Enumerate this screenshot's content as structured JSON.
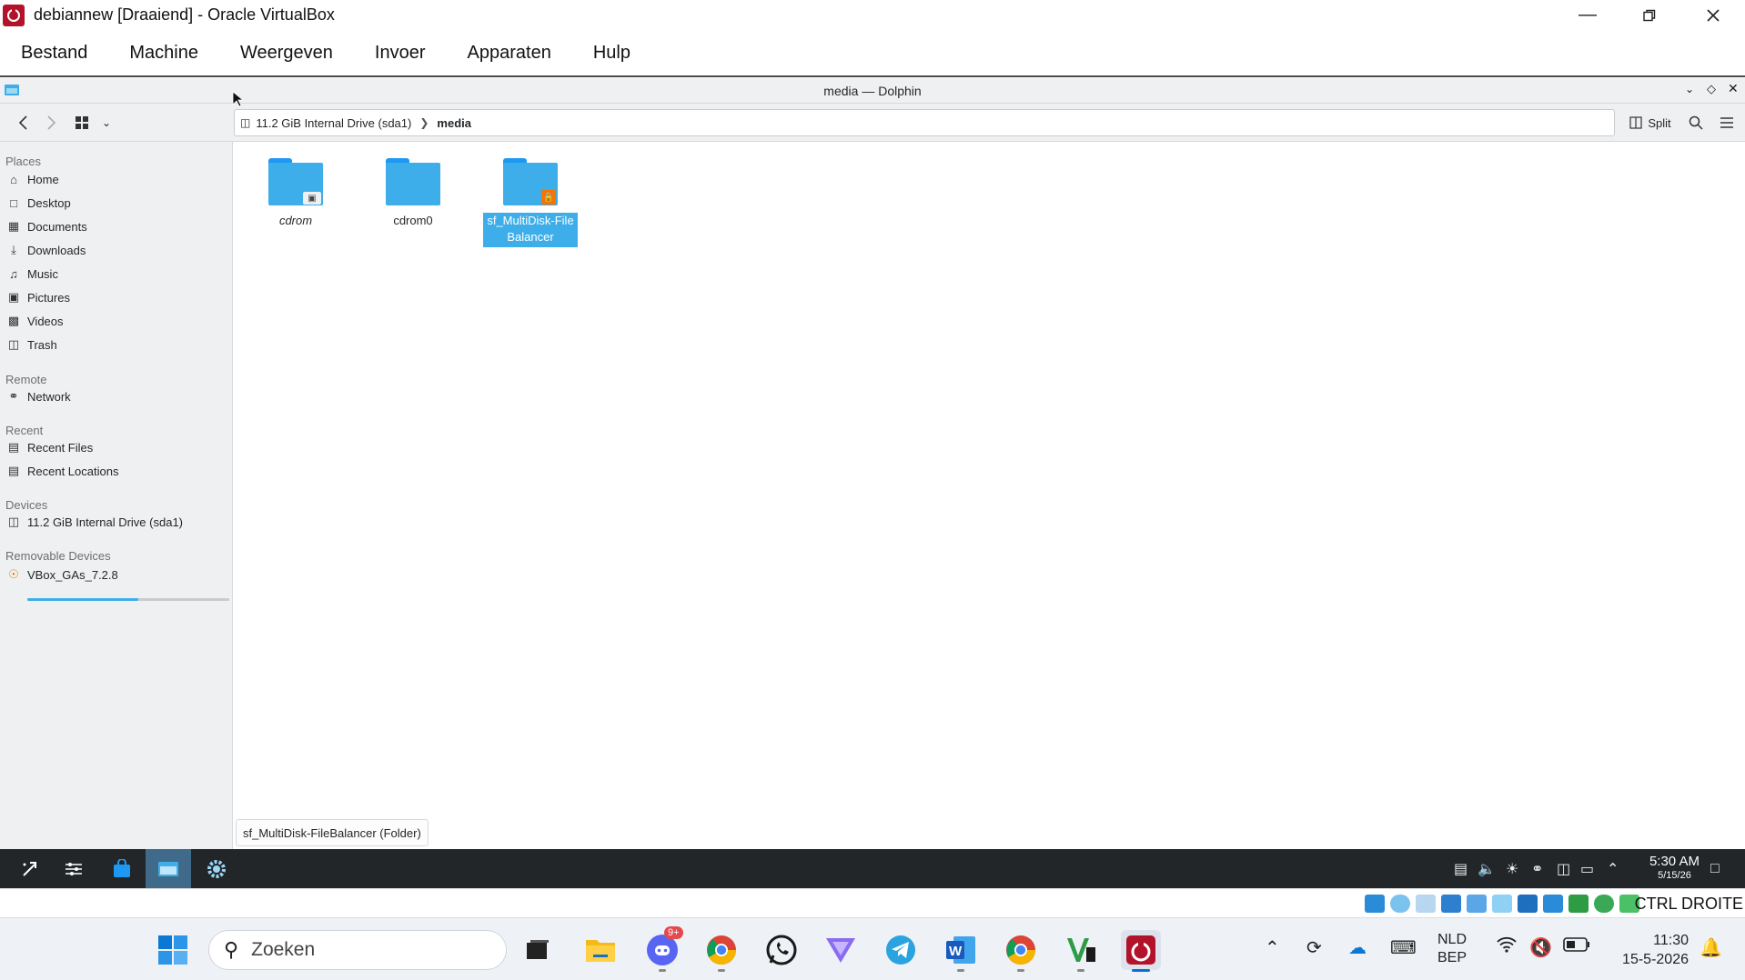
{
  "vbox": {
    "title": "debiannew [Draaiend] - Oracle VirtualBox",
    "menu": [
      "Bestand",
      "Machine",
      "Weergeven",
      "Invoer",
      "Apparaten",
      "Hulp"
    ],
    "host_key": "CTRL DROITE"
  },
  "dolphin": {
    "title": "media — Dolphin",
    "toolbar": {
      "split_label": "Split"
    },
    "location": {
      "drive": "11.2 GiB Internal Drive (sda1)",
      "current": "media"
    },
    "sidebar": {
      "places_header": "Places",
      "places": [
        "Home",
        "Desktop",
        "Documents",
        "Downloads",
        "Music",
        "Pictures",
        "Videos",
        "Trash"
      ],
      "remote_header": "Remote",
      "remote": [
        "Network"
      ],
      "recent_header": "Recent",
      "recent": [
        "Recent Files",
        "Recent Locations"
      ],
      "devices_header": "Devices",
      "devices": [
        "11.2 GiB Internal Drive (sda1)"
      ],
      "drive_usage_fraction": 0.55,
      "removable_header": "Removable Devices",
      "removable": [
        "VBox_GAs_7.2.8"
      ]
    },
    "folders": [
      {
        "name": "cdrom",
        "badge": "drive"
      },
      {
        "name": "cdrom0",
        "badge": ""
      },
      {
        "name_line1": "sf_MultiDisk-File",
        "name_line2": "Balancer",
        "badge": "lock",
        "selected": true
      }
    ],
    "status": "sf_MultiDisk-FileBalancer (Folder)"
  },
  "guest_panel": {
    "time": "5:30 AM",
    "date": "5/15/26"
  },
  "host_taskbar": {
    "search_placeholder": "Zoeken",
    "discord_badge": "9+",
    "lang_line1": "NLD",
    "lang_line2": "BEP",
    "time": "11:30",
    "date": "15-5-2026"
  }
}
